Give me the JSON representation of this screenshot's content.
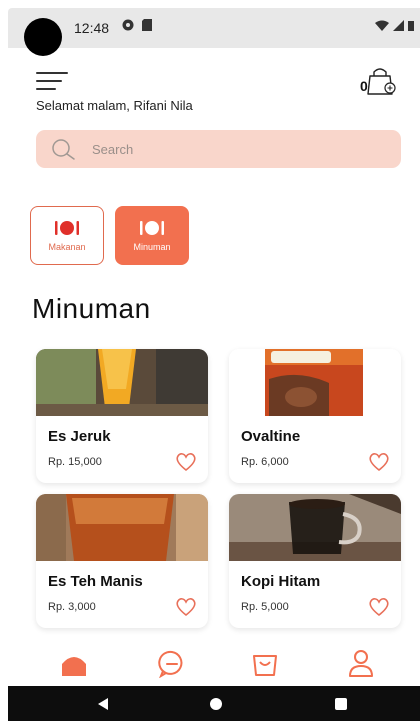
{
  "status_bar": {
    "time": "12:48"
  },
  "header": {
    "cart_count": "0",
    "greeting": "Selamat malam, Rifani Nila"
  },
  "search": {
    "placeholder": "Search"
  },
  "categories": [
    {
      "label": "Makanan",
      "icon": "plate-icon",
      "selected": false
    },
    {
      "label": "Minuman",
      "icon": "plate-icon",
      "selected": true
    }
  ],
  "section_title": "Minuman",
  "products": [
    {
      "name": "Es Jeruk",
      "price": "Rp. 15,000"
    },
    {
      "name": "Ovaltine",
      "price": "Rp. 6,000"
    },
    {
      "name": "Es Teh Manis",
      "price": "Rp. 3,000"
    },
    {
      "name": "Kopi Hitam",
      "price": "Rp. 5,000"
    }
  ],
  "bottom_nav": [
    {
      "icon": "home-icon",
      "active": true
    },
    {
      "icon": "chat-icon",
      "active": false
    },
    {
      "icon": "bag-icon",
      "active": false
    },
    {
      "icon": "profile-icon",
      "active": false
    }
  ],
  "system_nav": [
    {
      "icon": "back-icon"
    },
    {
      "icon": "home-dot-icon"
    },
    {
      "icon": "recents-icon"
    }
  ],
  "colors": {
    "accent": "#f2704f",
    "search_bg": "#f9d6cb"
  }
}
